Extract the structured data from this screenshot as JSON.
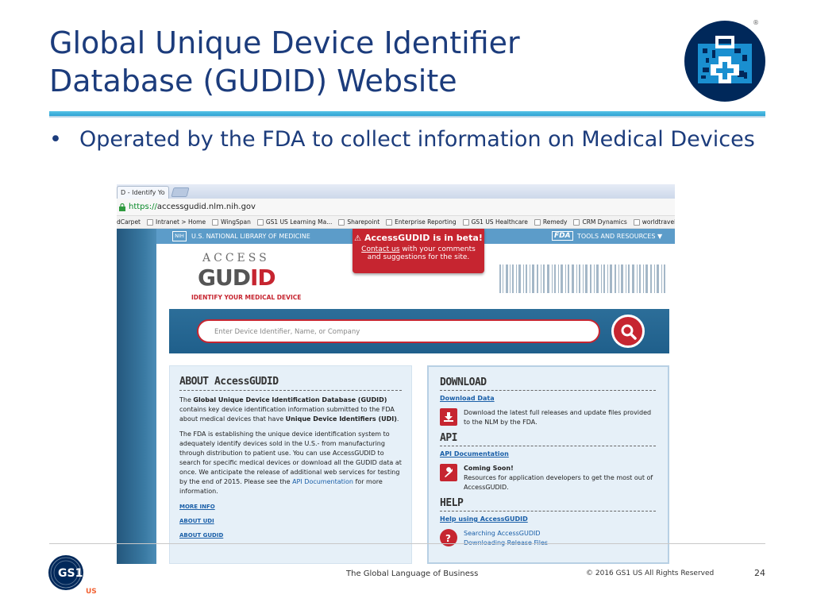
{
  "slide": {
    "title": "Global Unique Device Identifier Database (GUDID) Website",
    "bullet": "Operated by the FDA to collect information on Medical Devices",
    "footer_center": "The Global Language of Business",
    "footer_right": "© 2016 GS1 US All Rights Reserved",
    "page_number": "24",
    "logo_text": "GS1",
    "logo_sub": "US",
    "badge_reg": "®"
  },
  "browser": {
    "tab_label": "D - Identify Yo",
    "url_https": "https://",
    "url_rest": "accessgudid.nlm.nih.gov",
    "bookmarks": [
      "dCarpet",
      "Intranet > Home",
      "WingSpan",
      "GS1 US Learning Ma...",
      "Sharepoint",
      "Enterprise Reporting",
      "GS1 US Healthcare",
      "Remedy",
      "CRM Dynamics",
      "worldtravelin"
    ]
  },
  "site": {
    "nlm_logo": "NIH",
    "nlm_label": "U.S. NATIONAL LIBRARY OF MEDICINE",
    "fda_label": "FDA",
    "tools_label": "TOOLS AND RESOURCES ▼",
    "beta_warn": "⚠",
    "beta_title": "AccessGUDID is in beta!",
    "beta_link": "Contact us",
    "beta_line1_rest": " with your comments",
    "beta_line2": "and suggestions for the site.",
    "access": "ACCESS",
    "gudid_a": "GUD",
    "gudid_b": "ID",
    "tagline": "IDENTIFY YOUR MEDICAL DEVICE",
    "search_placeholder": "Enter Device Identifier, Name, or Company",
    "about": {
      "heading": "ABOUT AccessGUDID",
      "p1_a": "The ",
      "p1_b": "Global Unique Device Identification Database (GUDID)",
      "p1_c": " contains key device identification information submitted to the FDA about medical devices that have ",
      "p1_d": "Unique Device Identifiers (UDI)",
      "p1_e": ".",
      "p2_a": "The FDA is establishing the unique device identification system to adequately identify devices sold in the U.S.- from manufacturing through distribution to patient use. You can use AccessGUDID to search for specific medical devices or download all the GUDID data at once. We anticipate the release of additional web services for testing by the end of 2015. Please see the ",
      "p2_link": "API Documentation",
      "p2_b": " for more information.",
      "links": [
        "MORE INFO",
        "ABOUT UDI",
        "ABOUT GUDID"
      ]
    },
    "download": {
      "heading": "DOWNLOAD",
      "link": "Download Data",
      "text": "Download the latest full releases and update files provided to the NLM by the FDA.",
      "api_heading": "API",
      "api_link": "API Documentation",
      "api_title": "Coming Soon!",
      "api_text": "Resources for application developers to get the most out of AccessGUDID.",
      "help_heading": "HELP",
      "help_link": "Help using AccessGUDID",
      "help_items": [
        "Searching AccessGUDID",
        "Downloading Release Files"
      ]
    }
  }
}
